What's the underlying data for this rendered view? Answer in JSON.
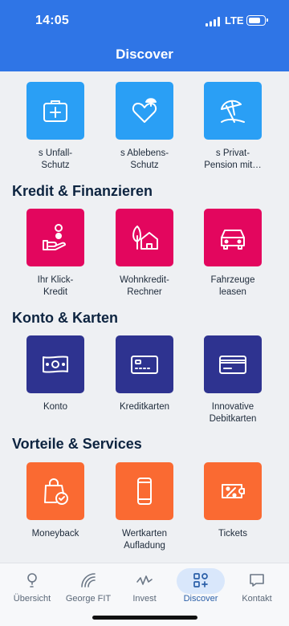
{
  "status": {
    "time": "14:05",
    "network": "LTE"
  },
  "header": {
    "title": "Discover"
  },
  "sections": [
    {
      "title": "",
      "items": [
        {
          "label": "s Unfall-\nSchutz",
          "icon": "first-aid-kit-icon"
        },
        {
          "label": "s Ablebens-\nSchutz",
          "icon": "heart-umbrella-icon"
        },
        {
          "label": "s Privat-\nPension mit…",
          "icon": "beach-umbrella-icon"
        }
      ]
    },
    {
      "title": "Kredit & Finanzieren",
      "items": [
        {
          "label": "Ihr Klick-\nKredit",
          "icon": "hand-coins-icon"
        },
        {
          "label": "Wohnkredit-\nRechner",
          "icon": "house-tree-icon"
        },
        {
          "label": "Fahrzeuge\nleasen",
          "icon": "car-icon"
        }
      ]
    },
    {
      "title": "Konto & Karten",
      "items": [
        {
          "label": "Konto",
          "icon": "banknote-icon"
        },
        {
          "label": "Kreditkarten",
          "icon": "credit-card-icon"
        },
        {
          "label": "Innovative\nDebitkarten",
          "icon": "debit-card-icon"
        }
      ]
    },
    {
      "title": "Vorteile & Services",
      "items": [
        {
          "label": "Moneyback",
          "icon": "shopping-bag-check-icon"
        },
        {
          "label": "Wertkarten\nAufladung",
          "icon": "smartphone-icon"
        },
        {
          "label": "Tickets",
          "icon": "percent-ticket-icon"
        }
      ]
    }
  ],
  "tabbar": [
    {
      "label": "Übersicht",
      "icon": "overview-icon"
    },
    {
      "label": "George FIT",
      "icon": "george-fit-icon"
    },
    {
      "label": "Invest",
      "icon": "invest-icon"
    },
    {
      "label": "Discover",
      "icon": "discover-icon",
      "active": true
    },
    {
      "label": "Kontakt",
      "icon": "chat-icon"
    }
  ],
  "colors": {
    "header": "#2f75e6",
    "insurance": "#2a9ff5",
    "credit": "#e3065e",
    "accounts": "#2e3390",
    "benefits": "#fa6a32"
  }
}
